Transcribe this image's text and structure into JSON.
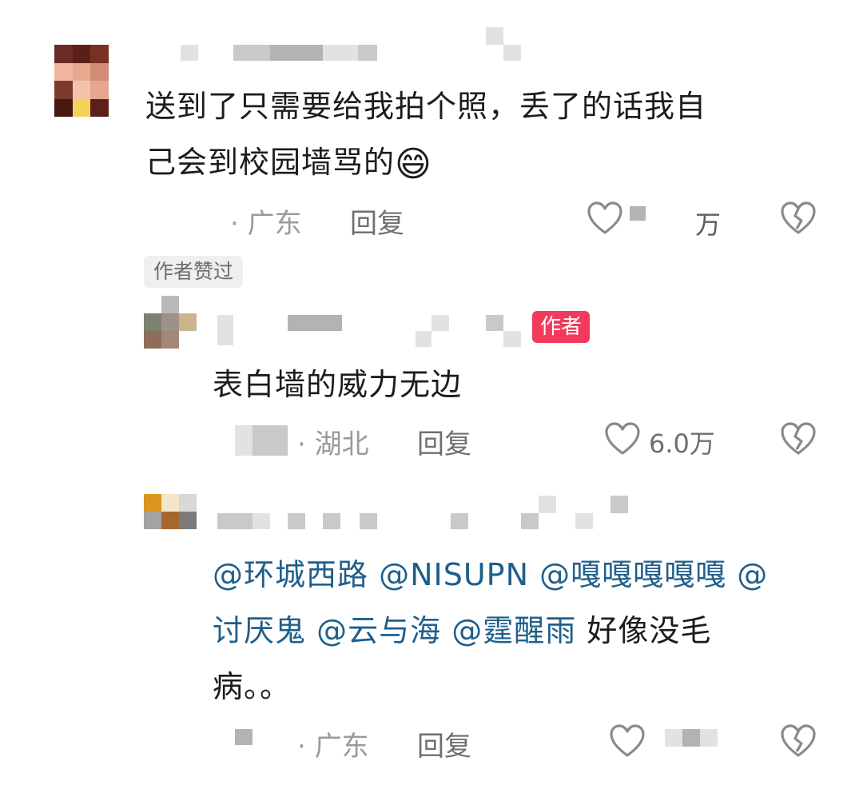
{
  "comment1": {
    "text_line1": "送到了只需要给我拍个照，丢了的话我自",
    "text_line2": "己会到校园墙骂的",
    "emoji": "😄",
    "location": "· 广东",
    "reply_label": "回复",
    "like_count_suffix": "万",
    "author_liked_tag": "作者赞过"
  },
  "reply1": {
    "author_badge": "作者",
    "text": "表白墙的威力无边",
    "location": "· 湖北",
    "reply_label": "回复",
    "like_count": "6.0万"
  },
  "reply2": {
    "mentions_line1": [
      "@环城西路",
      "@NISUPN",
      "@嘎嘎嘎嘎嘎",
      "@"
    ],
    "mentions_line2": [
      "讨厌鬼",
      "@云与海",
      "@霆醒雨"
    ],
    "text_line2_tail": "好像没毛",
    "text_line3": "病。。",
    "location": "· 广东",
    "reply_label": "回复"
  },
  "colors": {
    "mention": "#1f5f8b",
    "author_badge": "#f23b5c",
    "meta": "#9a9a9a"
  },
  "icons": [
    "heart-outline-icon",
    "broken-heart-icon",
    "emoji-grin-icon"
  ]
}
